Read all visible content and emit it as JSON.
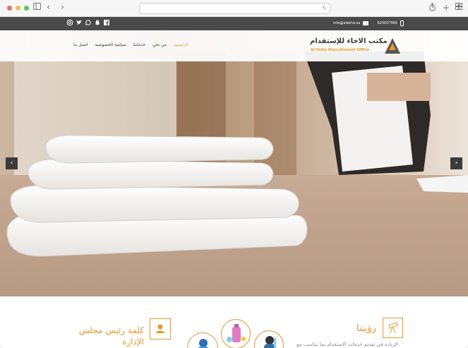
{
  "browser": {
    "url": "",
    "icons": [
      "sidebar-icon",
      "back-icon",
      "forward-icon",
      "share-icon",
      "new-tab-icon",
      "tabs-icon",
      "reload-icon"
    ]
  },
  "topbar": {
    "email": "info@alekha.sa",
    "phone": "920007966",
    "social": [
      "instagram",
      "twitter",
      "whatsapp",
      "snapchat",
      "facebook"
    ]
  },
  "logo": {
    "arabic": "مكتب الاخاء للإستقدام",
    "english": "Al Ekha Recruitment Office"
  },
  "nav": {
    "items": [
      {
        "label": "الرئيسية",
        "active": true
      },
      {
        "label": "من نحن",
        "active": false
      },
      {
        "label": "خدماتنا",
        "active": false
      },
      {
        "label": "سياسة الخصوصية",
        "active": false
      },
      {
        "label": "اتصل بنا",
        "active": false
      }
    ]
  },
  "hero": {
    "prev": "‹",
    "next": "›"
  },
  "sections": {
    "vision_title": "رؤيتنا",
    "vision_text": "الريادة في تقديم خدمات الاستقدام بما يتناسب مع",
    "chairman_title": "كلمة رئيس مجلس الإدارة"
  },
  "colors": {
    "accent": "#e8962b",
    "topbar": "#4a4a4a"
  }
}
